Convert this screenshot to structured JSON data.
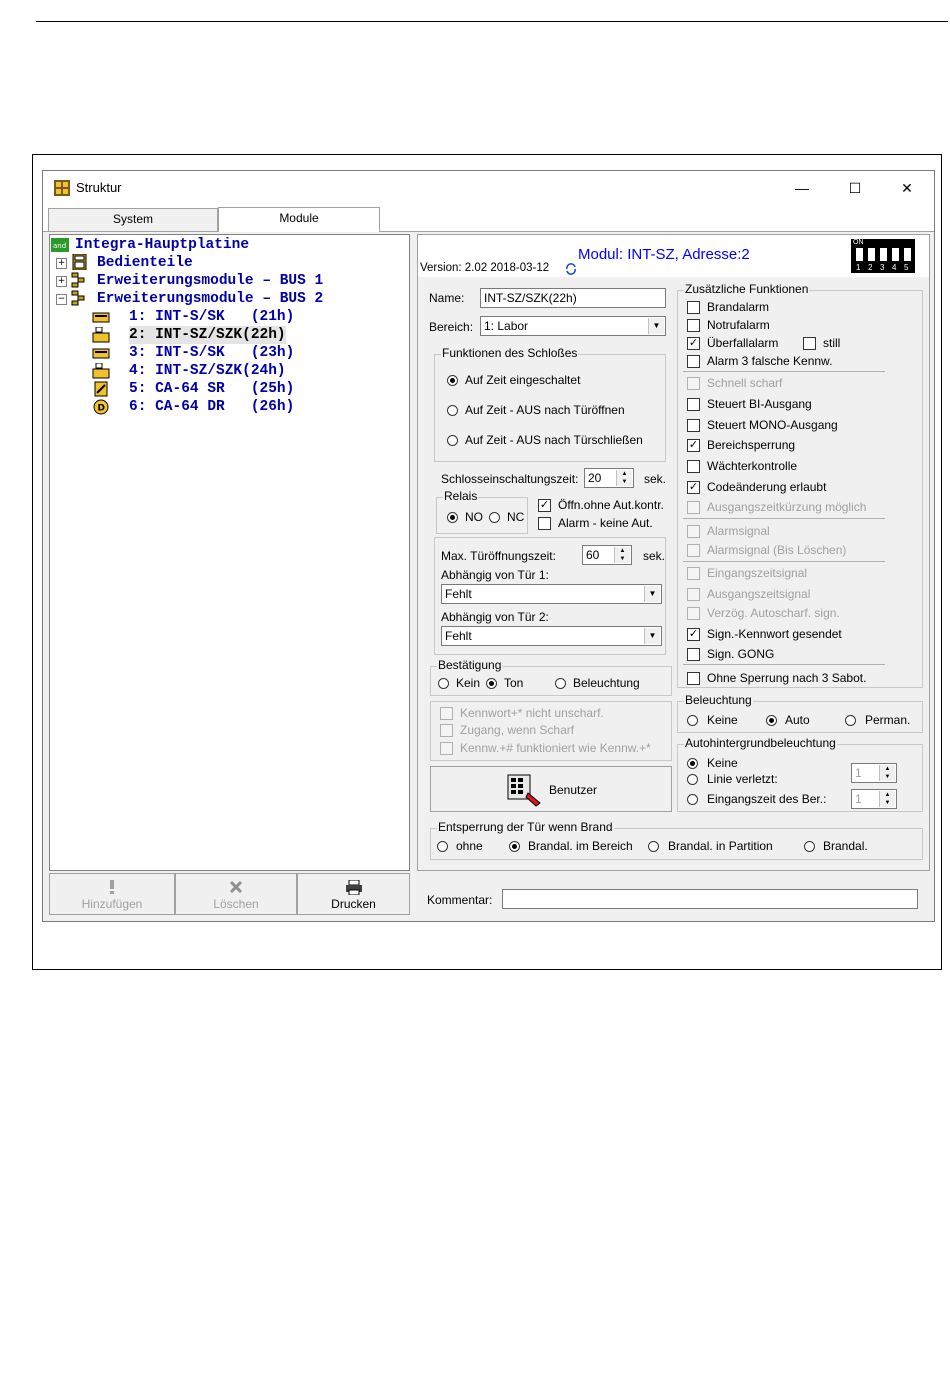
{
  "window": {
    "title": "Struktur",
    "controls": {
      "minimize": "—",
      "maximize": "☐",
      "close": "✕"
    }
  },
  "tabs": [
    {
      "label": "System"
    },
    {
      "label": "Module"
    }
  ],
  "tree": {
    "root": "Integra-Hauptplatine",
    "items": [
      {
        "label": "Bedienteile"
      },
      {
        "label": "Erweiterungsmodule – BUS 1"
      },
      {
        "label": "Erweiterungsmodule – BUS 2"
      },
      {
        "label": "1: INT-S/SK   (21h)"
      },
      {
        "label": "2: INT-SZ/SZK(22h)"
      },
      {
        "label": "3: INT-S/SK   (23h)"
      },
      {
        "label": "4: INT-SZ/SZK(24h)"
      },
      {
        "label": "5: CA-64 SR   (25h)"
      },
      {
        "label": "6: CA-64 DR   (26h)"
      }
    ]
  },
  "bottom_buttons": {
    "add": "Hinzufügen",
    "delete": "Löschen",
    "print": "Drucken"
  },
  "header": {
    "version": "Version: 2.02 2018-03-12",
    "module_title": "Modul: INT-SZ, Adresse:2",
    "dip_on": "ON",
    "dip_numbers": [
      "1",
      "2",
      "3",
      "4",
      "5"
    ]
  },
  "name": {
    "label": "Name:",
    "value": "INT-SZ/SZK(22h)"
  },
  "bereich": {
    "label": "Bereich:",
    "value": "1: Labor"
  },
  "lock_functions": {
    "title": "Funktionen des Schloßes",
    "options": [
      "Auf Zeit eingeschaltet",
      "Auf Zeit - AUS nach Türöffnen",
      "Auf Zeit - AUS nach Türschließen"
    ]
  },
  "lock_time": {
    "label": "Schlosseinschaltungszeit:",
    "value": "20",
    "unit": "sek."
  },
  "relais": {
    "title": "Relais",
    "no": "NO",
    "nc": "NC"
  },
  "open_without": "Öffn.ohne Aut.kontr.",
  "alarm_no_aut": "Alarm - keine Aut.",
  "max_open": {
    "label": "Max. Türöffnungszeit:",
    "value": "60",
    "unit": "sek."
  },
  "door1": {
    "label": "Abhängig von Tür 1:",
    "value": "Fehlt"
  },
  "door2": {
    "label": "Abhängig von Tür 2:",
    "value": "Fehlt"
  },
  "confirm": {
    "title": "Bestätigung",
    "kein": "Kein",
    "ton": "Ton",
    "beleuchtung": "Beleuchtung"
  },
  "disabled_opts": [
    "Kennwort+* nicht unscharf.",
    "Zugang, wenn Scharf",
    "Kennw.+# funktioniert wie Kennw.+*"
  ],
  "benutzer": "Benutzer",
  "extra": {
    "title": "Zusätzliche Funktionen",
    "brandalarm": "Brandalarm",
    "notrufalarm": "Notrufalarm",
    "ueberfall": "Überfallalarm",
    "still": "still",
    "alarm3": "Alarm 3 falsche Kennw.",
    "schnell": "Schnell scharf",
    "bi": "Steuert BI-Ausgang",
    "mono": "Steuert MONO-Ausgang",
    "bereichsperrung": "Bereichsperrung",
    "waechter": "Wächterkontrolle",
    "code": "Codeänderung erlaubt",
    "ausgangszeit": "Ausgangszeitkürzung möglich",
    "alarmsignal": "Alarmsignal",
    "alarmsignal_bis": "Alarmsignal (Bis Löschen)",
    "eingangszeitsignal": "Eingangszeitsignal",
    "ausgangszeitsignal": "Ausgangszeitsignal",
    "verzoeg": "Verzög. Autoscharf. sign.",
    "sign_kennwort": "Sign.-Kennwort gesendet",
    "gong": "Sign. GONG",
    "ohne_sperrung": "Ohne Sperrung nach 3 Sabot."
  },
  "beleuchtung": {
    "title": "Beleuchtung",
    "keine": "Keine",
    "auto": "Auto",
    "perman": "Perman."
  },
  "autohint": {
    "title": "Autohintergrundbeleuchtung",
    "keine": "Keine",
    "linie": "Linie verletzt:",
    "linie_val": "1",
    "eingang": "Eingangszeit des Ber.:",
    "eingang_val": "1"
  },
  "entsperrung": {
    "title": "Entsperrung der Tür wenn Brand",
    "ohne": "ohne",
    "bereich": "Brandal. im Bereich",
    "partition": "Brandal. in Partition",
    "brandal": "Brandal."
  },
  "kommentar": {
    "label": "Kommentar:",
    "value": ""
  },
  "colors": {
    "tree_text": "#0000a8",
    "header_title": "#0000ff"
  }
}
